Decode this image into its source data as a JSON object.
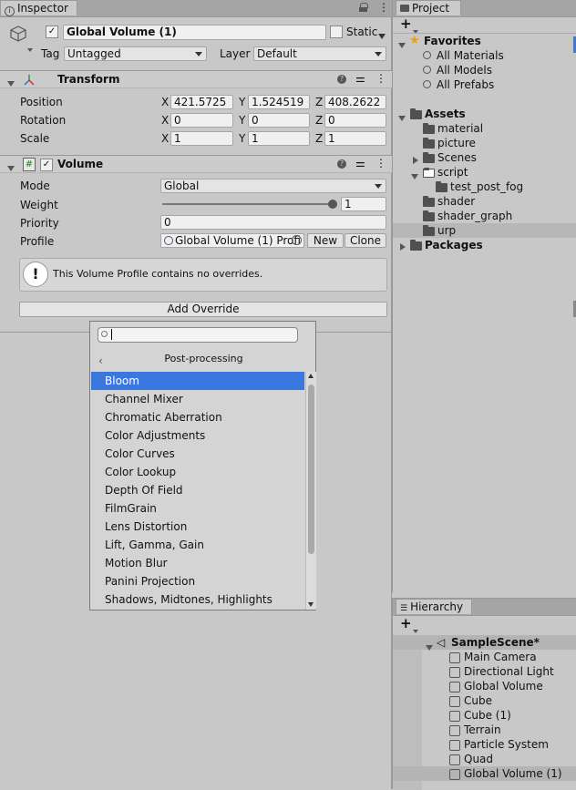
{
  "inspector": {
    "tab_label": "Inspector",
    "object": {
      "name": "Global Volume (1)",
      "static_label": "Static"
    },
    "tag_label": "Tag",
    "tag_value": "Untagged",
    "layer_label": "Layer",
    "layer_value": "Default",
    "transform": {
      "title": "Transform",
      "position_label": "Position",
      "rotation_label": "Rotation",
      "scale_label": "Scale",
      "x": "X",
      "y": "Y",
      "z": "Z",
      "position": [
        "421.5725",
        "1.524519",
        "408.2622"
      ],
      "rotation": [
        "0",
        "0",
        "0"
      ],
      "scale": [
        "1",
        "1",
        "1"
      ]
    },
    "volume": {
      "title": "Volume",
      "mode_label": "Mode",
      "mode_value": "Global",
      "weight_label": "Weight",
      "weight_value": "1",
      "weight_fraction": 1.0,
      "priority_label": "Priority",
      "priority_value": "0",
      "profile_label": "Profile",
      "profile_value": "Global Volume (1) Profi",
      "new_label": "New",
      "clone_label": "Clone",
      "info_text": "This Volume Profile contains no overrides.",
      "add_override_label": "Add Override"
    }
  },
  "popup": {
    "search_placeholder": "",
    "category": "Post-processing",
    "items": [
      "Bloom",
      "Channel Mixer",
      "Chromatic Aberration",
      "Color Adjustments",
      "Color Curves",
      "Color Lookup",
      "Depth Of Field",
      "FilmGrain",
      "Lens Distortion",
      "Lift, Gamma, Gain",
      "Motion Blur",
      "Panini Projection",
      "Shadows, Midtones, Highlights"
    ],
    "selected": "Bloom"
  },
  "project": {
    "tab_label": "Project",
    "favorites_label": "Favorites",
    "favorites": [
      "All Materials",
      "All Models",
      "All Prefabs"
    ],
    "assets_label": "Assets",
    "assets": [
      "material",
      "picture",
      "Scenes",
      "script",
      "test_post_fog",
      "shader",
      "shader_graph",
      "urp"
    ],
    "packages_label": "Packages"
  },
  "hierarchy": {
    "tab_label": "Hierarchy",
    "scene": "SampleScene*",
    "items": [
      "Main Camera",
      "Directional Light",
      "Global Volume",
      "Cube",
      "Cube (1)",
      "Terrain",
      "Particle System",
      "Quad",
      "Global Volume (1)"
    ]
  },
  "colors": {
    "selection": "#3a78e0",
    "favorites_star": "#e6a317",
    "row_highlight": "#b7b7b7"
  }
}
